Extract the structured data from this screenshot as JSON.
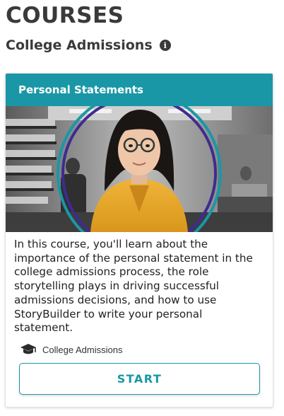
{
  "page": {
    "heading": "COURSES"
  },
  "section": {
    "title": "College Admissions",
    "info_icon": "info-icon"
  },
  "course_card": {
    "title": "Personal Statements",
    "header_color": "#1a97a6",
    "image": "student-portrait-photo",
    "description": "In this course, you'll learn about the importance of the personal statement in the college admissions process, the role storytelling plays in driving successful admissions decisions, and how to use StoryBuilder to write your personal statement.",
    "category_icon": "graduation-cap-icon",
    "category": "College Admissions",
    "start_label": "START"
  }
}
